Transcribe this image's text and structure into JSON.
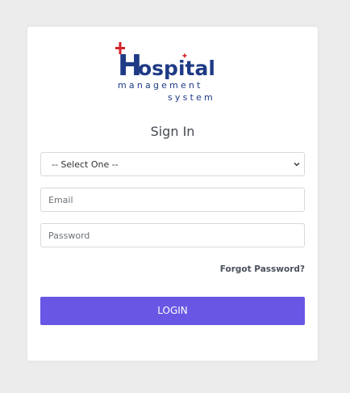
{
  "brand": {
    "logo_word": "Hospital",
    "logo_tagline_line1": "management",
    "logo_tagline_line2": "system",
    "accent_red": "#d3232b",
    "brand_blue": "#1f3b86"
  },
  "signin": {
    "title": "Sign In",
    "role_select": {
      "selected": "-- Select One --"
    },
    "email": {
      "placeholder": "Email",
      "value": ""
    },
    "password": {
      "placeholder": "Password",
      "value": ""
    },
    "forgot_label": "Forgot Password?",
    "login_label": "LOGIN",
    "login_color": "#6857e4"
  }
}
